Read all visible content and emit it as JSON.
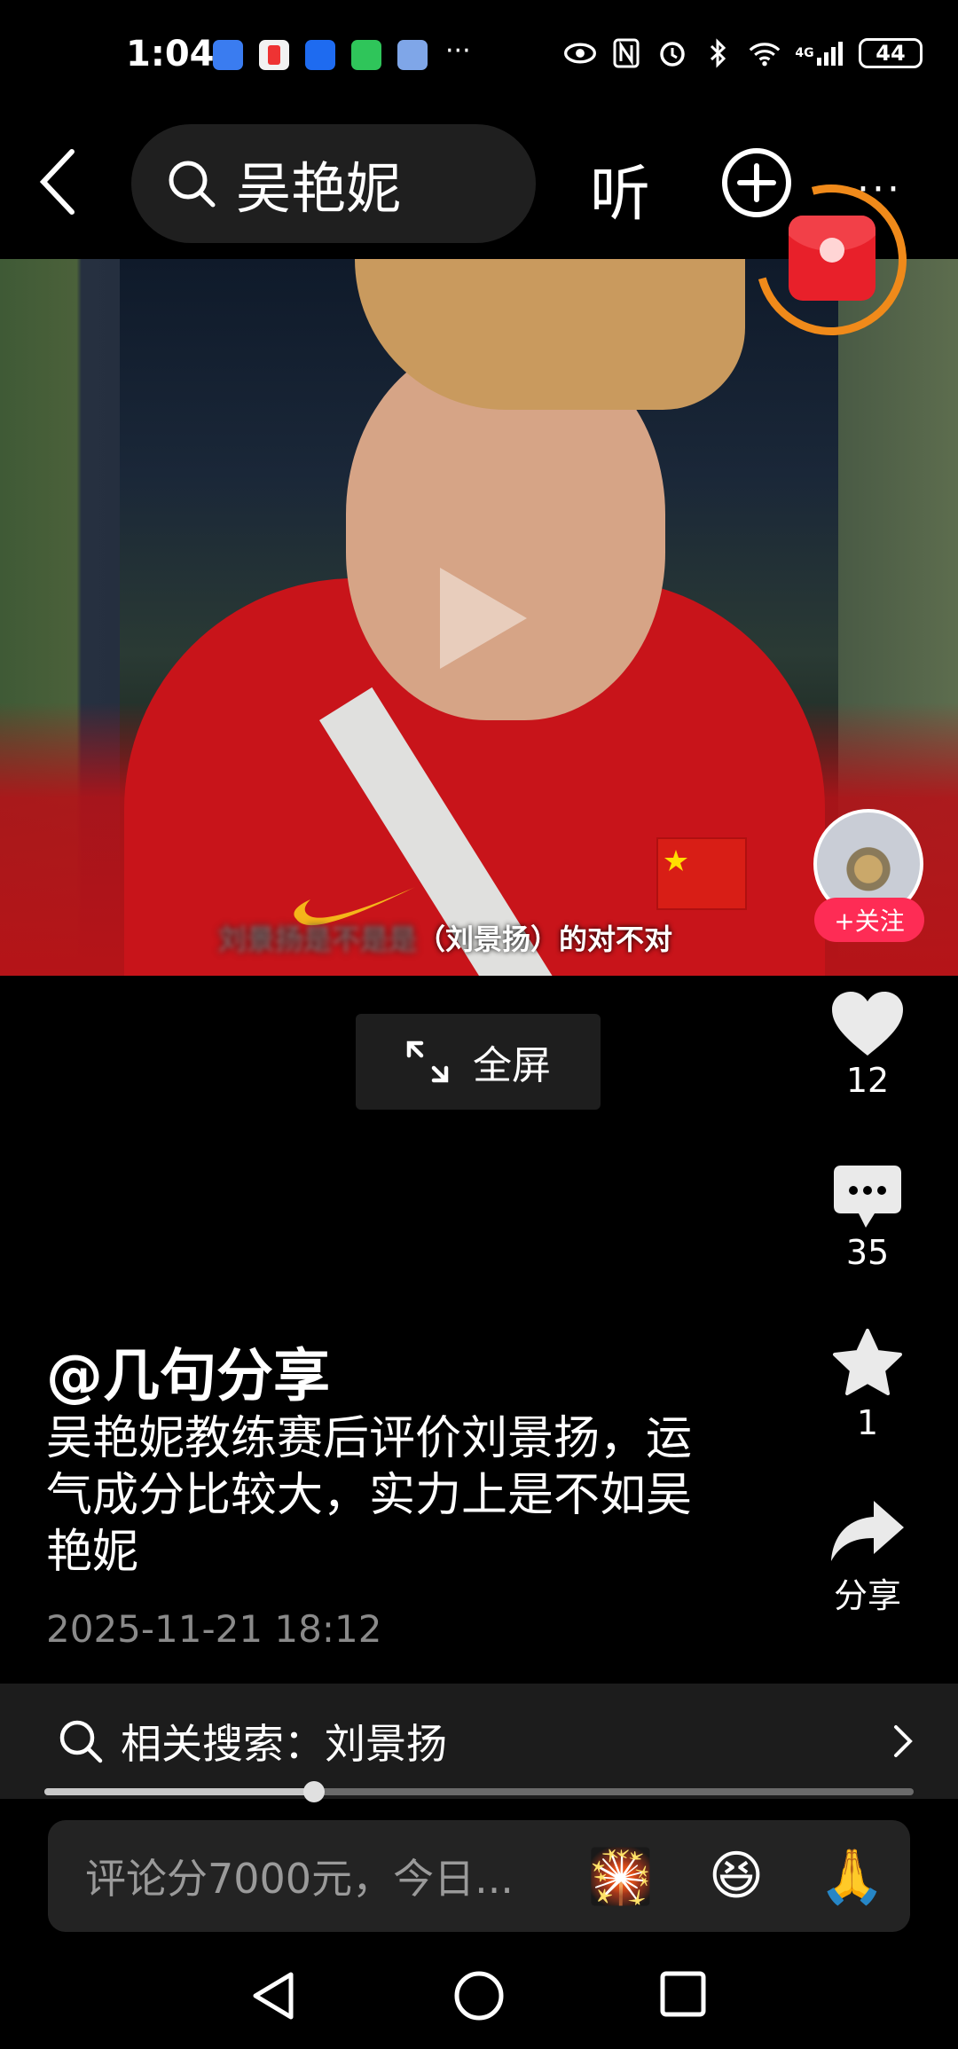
{
  "status_bar": {
    "time": "1:04",
    "network": "4G",
    "battery": "44",
    "more": "···"
  },
  "top_bar": {
    "search_query": "吴艳妮",
    "listen_label": "听",
    "more_label": "···"
  },
  "video": {
    "subtitle_blurred": "刘景扬是不是是",
    "subtitle": "（刘景扬）的对不对"
  },
  "author": {
    "follow_label": "+关注",
    "name": "@几句分享"
  },
  "fullscreen_label": "全屏",
  "actions": {
    "likes": "12",
    "comments": "35",
    "favorites": "1",
    "share_label": "分享"
  },
  "post": {
    "caption": "吴艳妮教练赛后评价刘景扬，运气成分比较大，实力上是不如吴艳妮",
    "timestamp": "2025-11-21 18:12"
  },
  "related_search": {
    "label": "相关搜索：刘景扬"
  },
  "playback": {
    "progress": 0.31
  },
  "comment_bar": {
    "placeholder": "评论分7000元，今日...",
    "emojis": [
      "🎇",
      "😆",
      "🙏"
    ]
  },
  "colors": {
    "accent_red": "#fe2c55",
    "ring_orange": "#f08a1a"
  }
}
